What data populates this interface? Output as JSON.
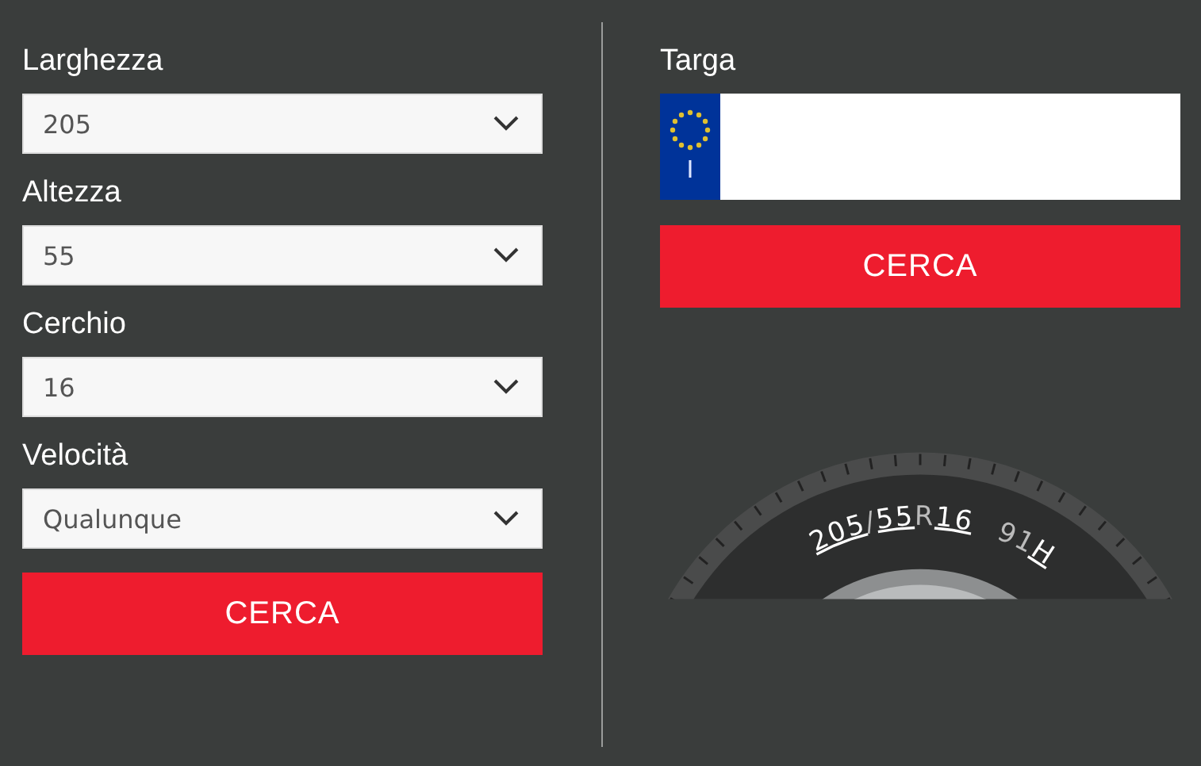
{
  "size_search": {
    "fields": [
      {
        "label": "Larghezza",
        "value": "205"
      },
      {
        "label": "Altezza",
        "value": "55"
      },
      {
        "label": "Cerchio",
        "value": "16"
      },
      {
        "label": "Velocità",
        "value": "Qualunque"
      }
    ],
    "button": "CERCA"
  },
  "plate_search": {
    "label": "Targa",
    "country_code": "I",
    "button": "CERCA"
  },
  "tire_markings": [
    {
      "text": "205",
      "underlined": true
    },
    {
      "text": "/",
      "underlined": false
    },
    {
      "text": "55",
      "underlined": true
    },
    {
      "text": "R",
      "underlined": false
    },
    {
      "text": "16",
      "underlined": true
    },
    {
      "text": "91",
      "underlined": false
    },
    {
      "text": "H",
      "underlined": true
    }
  ]
}
